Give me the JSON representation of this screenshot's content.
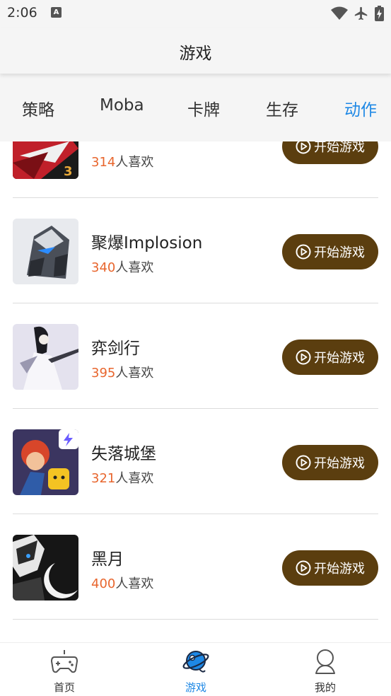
{
  "status_bar": {
    "time": "2:06",
    "keyboard_badge": "A"
  },
  "header": {
    "title": "游戏"
  },
  "tabs": [
    {
      "label": "策略"
    },
    {
      "label": "Moba"
    },
    {
      "label": "卡牌"
    },
    {
      "label": "生存"
    },
    {
      "label": "动作",
      "active": true
    }
  ],
  "games": [
    {
      "name": "",
      "likes": "314",
      "likes_suffix": "人喜欢",
      "button": "开始游戏",
      "art": "red-ninja"
    },
    {
      "name": "聚爆Implosion",
      "likes": "340",
      "likes_suffix": "人喜欢",
      "button": "开始游戏",
      "art": "mech"
    },
    {
      "name": "弈剑行",
      "likes": "395",
      "likes_suffix": "人喜欢",
      "button": "开始游戏",
      "art": "swordsman"
    },
    {
      "name": "失落城堡",
      "likes": "321",
      "likes_suffix": "人喜欢",
      "button": "开始游戏",
      "art": "castle"
    },
    {
      "name": "黑月",
      "likes": "400",
      "likes_suffix": "人喜欢",
      "button": "开始游戏",
      "art": "dark-moon"
    }
  ],
  "bottom_nav": [
    {
      "label": "首页",
      "icon": "gamepad-icon"
    },
    {
      "label": "游戏",
      "icon": "planet-icon",
      "active": true
    },
    {
      "label": "我的",
      "icon": "profile-icon"
    }
  ],
  "colors": {
    "accent": "#1e88e5",
    "button": "#5b3e0f",
    "likes_number": "#e8662e"
  }
}
